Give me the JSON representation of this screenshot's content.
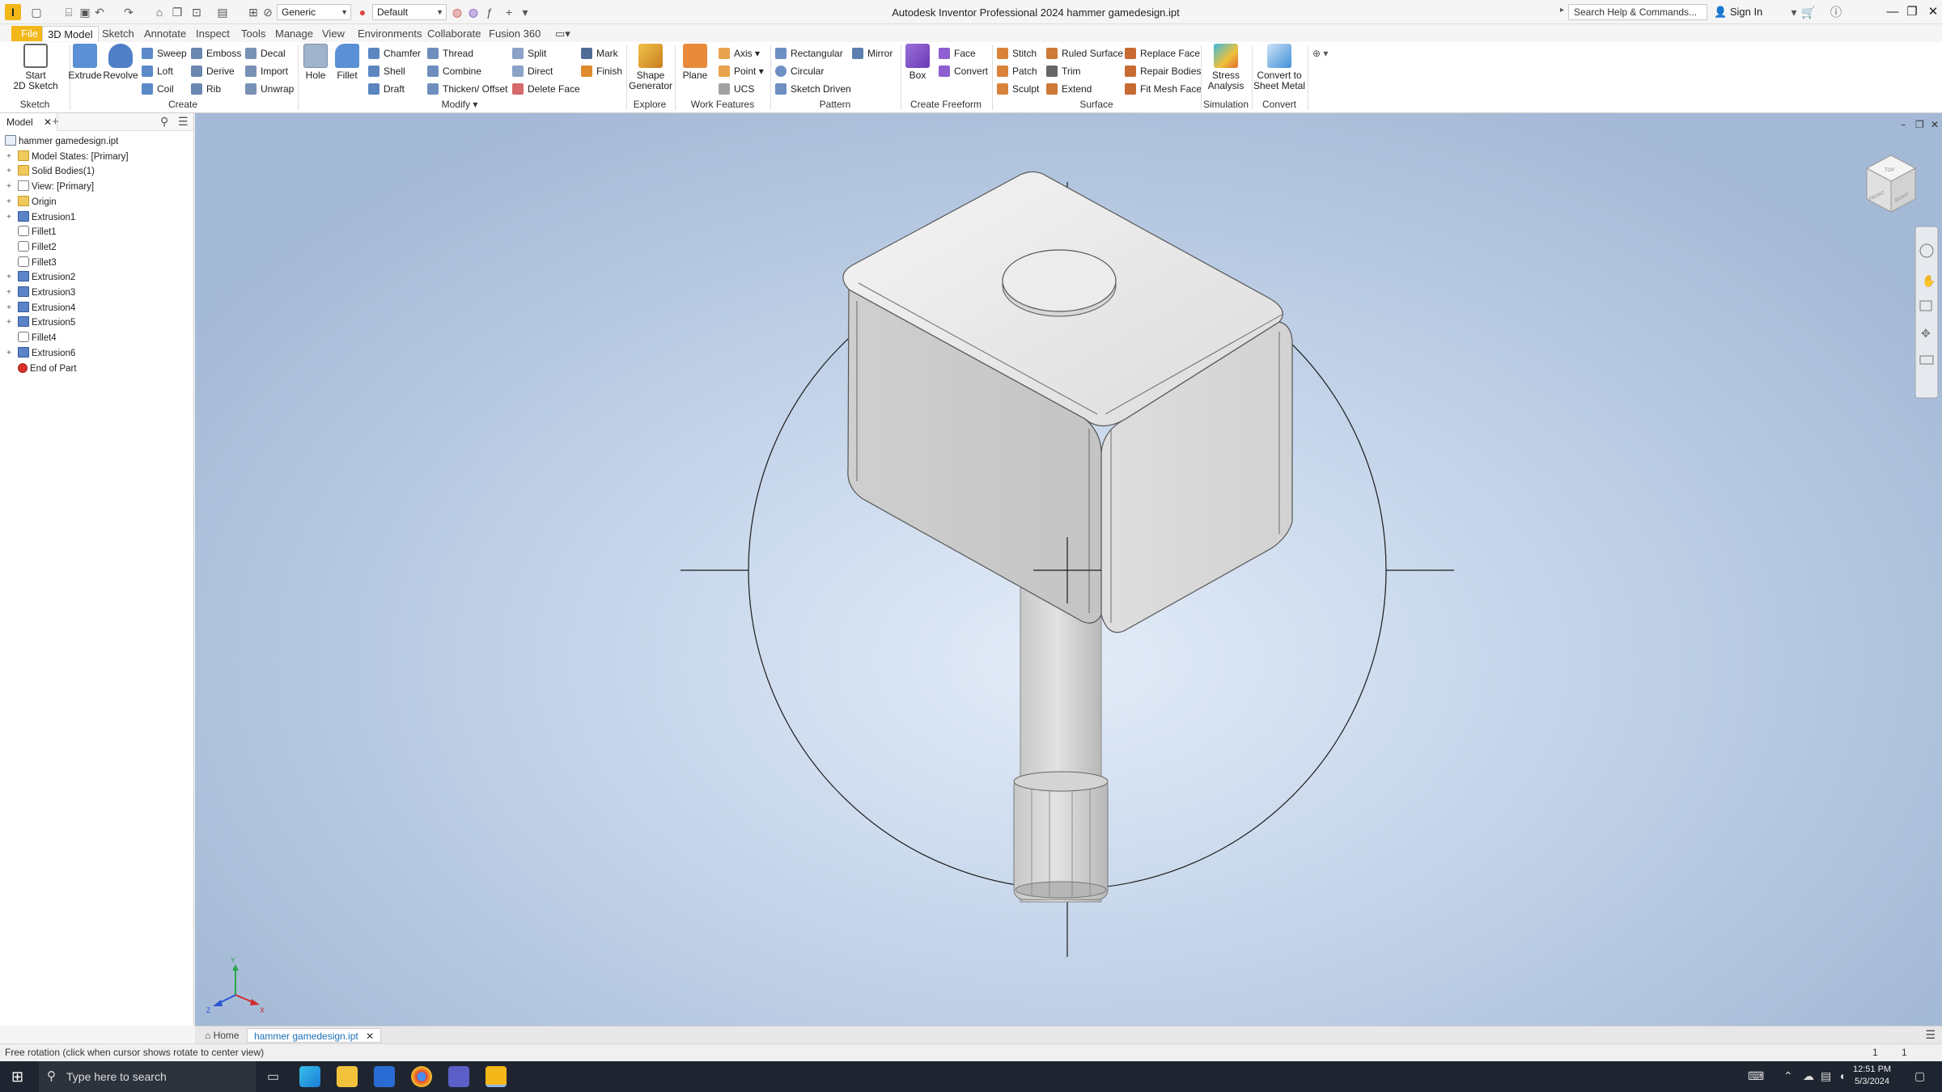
{
  "window": {
    "title": "Autodesk Inventor Professional 2024   hammer gamedesign.ipt",
    "material": "Generic",
    "appearance": "Default",
    "search_placeholder": "Search Help & Commands...",
    "sign_in": "Sign In"
  },
  "ribbon_tabs": [
    "File",
    "3D Model",
    "Sketch",
    "Annotate",
    "Inspect",
    "Tools",
    "Manage",
    "View",
    "Environments",
    "Collaborate",
    "Fusion 360"
  ],
  "ribbon": {
    "sketch": {
      "start_2d_sketch": "Start\n2D Sketch",
      "label": "Sketch"
    },
    "create": {
      "extrude": "Extrude",
      "revolve": "Revolve",
      "sweep": "Sweep",
      "emboss": "Emboss",
      "decal": "Decal",
      "loft": "Loft",
      "derive": "Derive",
      "import": "Import",
      "coil": "Coil",
      "rib": "Rib",
      "unwrap": "Unwrap",
      "label": "Create"
    },
    "modify": {
      "hole": "Hole",
      "fillet": "Fillet",
      "chamfer": "Chamfer",
      "thread": "Thread",
      "split": "Split",
      "shell": "Shell",
      "combine": "Combine",
      "direct": "Direct",
      "draft": "Draft",
      "thicken_offset": "Thicken/ Offset",
      "delete_face": "Delete Face",
      "label": "Modify"
    },
    "mark": {
      "mark": "Mark",
      "finish": "Finish"
    },
    "explore": {
      "shape_generator": "Shape\nGenerator",
      "label": "Explore"
    },
    "work_features": {
      "plane": "Plane",
      "axis": "Axis",
      "point": "Point",
      "ucs": "UCS",
      "label": "Work Features"
    },
    "pattern": {
      "rectangular": "Rectangular",
      "mirror": "Mirror",
      "circular": "Circular",
      "sketch_driven": "Sketch Driven",
      "label": "Pattern"
    },
    "freeform": {
      "box": "Box",
      "face": "Face",
      "convert": "Convert",
      "label": "Create Freeform"
    },
    "surface": {
      "stitch": "Stitch",
      "ruled_surface": "Ruled Surface",
      "replace_face": "Replace Face",
      "patch": "Patch",
      "trim": "Trim",
      "repair_bodies": "Repair Bodies",
      "sculpt": "Sculpt",
      "extend": "Extend",
      "fit_mesh_face": "Fit Mesh Face",
      "label": "Surface"
    },
    "simulation": {
      "stress_analysis": "Stress\nAnalysis",
      "label": "Simulation"
    },
    "convert": {
      "convert_sheet_metal": "Convert to\nSheet Metal",
      "label": "Convert"
    }
  },
  "browser": {
    "tab": "Model",
    "items": [
      {
        "label": "hammer gamedesign.ipt",
        "icon": "part-icon",
        "level": 0,
        "expandable": false
      },
      {
        "label": "Model States: [Primary]",
        "icon": "folder-icon",
        "level": 1,
        "expandable": true
      },
      {
        "label": "Solid Bodies(1)",
        "icon": "folder-icon",
        "level": 1,
        "expandable": true
      },
      {
        "label": "View: [Primary]",
        "icon": "view-icon",
        "level": 1,
        "expandable": true
      },
      {
        "label": "Origin",
        "icon": "folder-icon",
        "level": 1,
        "expandable": true
      },
      {
        "label": "Extrusion1",
        "icon": "extrude-icon",
        "level": 1,
        "expandable": true
      },
      {
        "label": "Fillet1",
        "icon": "fillet-icon",
        "level": 1,
        "expandable": false
      },
      {
        "label": "Fillet2",
        "icon": "fillet-icon",
        "level": 1,
        "expandable": false
      },
      {
        "label": "Fillet3",
        "icon": "fillet-icon",
        "level": 1,
        "expandable": false
      },
      {
        "label": "Extrusion2",
        "icon": "extrude-icon",
        "level": 1,
        "expandable": true
      },
      {
        "label": "Extrusion3",
        "icon": "extrude-icon",
        "level": 1,
        "expandable": true
      },
      {
        "label": "Extrusion4",
        "icon": "extrude-icon",
        "level": 1,
        "expandable": true
      },
      {
        "label": "Extrusion5",
        "icon": "extrude-icon",
        "level": 1,
        "expandable": true
      },
      {
        "label": "Fillet4",
        "icon": "fillet-icon",
        "level": 1,
        "expandable": false
      },
      {
        "label": "Extrusion6",
        "icon": "extrude-icon",
        "level": 1,
        "expandable": true
      },
      {
        "label": "End of Part",
        "icon": "end-of-part-icon",
        "level": 1,
        "expandable": false
      }
    ]
  },
  "viewcube": {
    "top": "TOP",
    "front": "FRONT",
    "right": "RIGHT"
  },
  "triad": {
    "x": "X",
    "y": "Y",
    "z": "Z"
  },
  "doc_tabs": {
    "home": "Home",
    "active": "hammer gamedesign.ipt"
  },
  "status": {
    "message": "Free rotation (click when cursor shows rotate to center view)",
    "count1": "1",
    "count2": "1"
  },
  "taskbar": {
    "search": "Type here to search",
    "time": "12:51 PM",
    "date": "5/3/2024"
  },
  "colors": {
    "accent": "#f3b718",
    "viewport_top": "#a4b9d6",
    "viewport_center": "#e3ecf8",
    "active_tab_text": "#1a6fb8"
  }
}
